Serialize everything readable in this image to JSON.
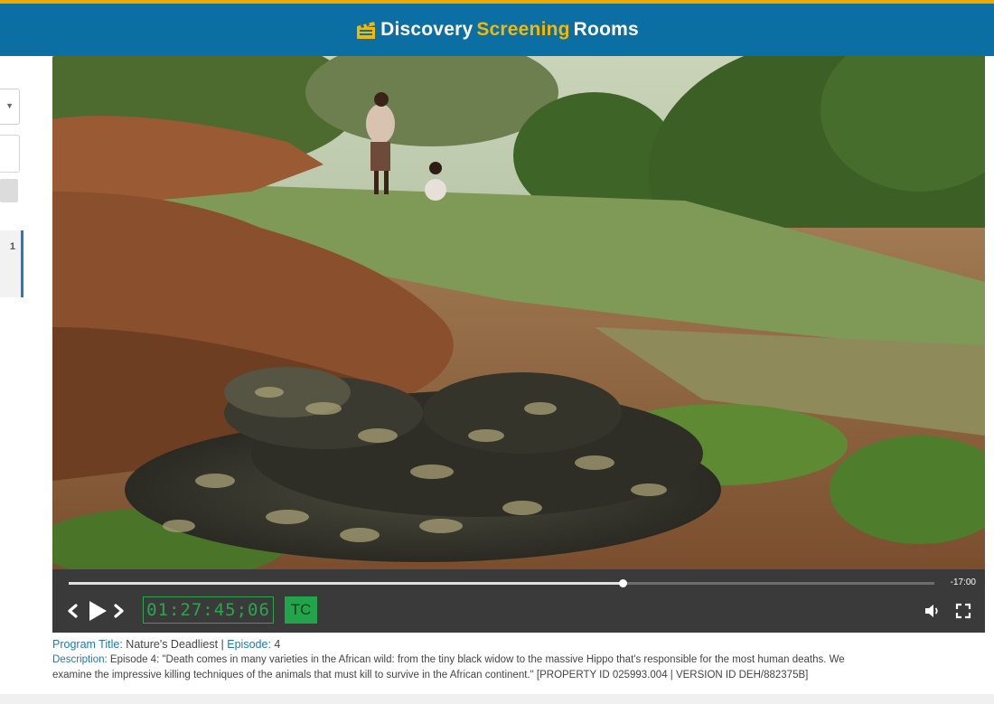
{
  "header": {
    "brand_part1": "Discovery",
    "brand_part2": "Screening",
    "brand_part3": "Rooms",
    "logo_icon": "clapperboard-icon",
    "brand_color": "#0b6fa3",
    "accent_color": "#f5b800"
  },
  "sidebar": {
    "item_number": "1"
  },
  "player": {
    "remaining": "-17:00",
    "timecode": "01:27:45;06",
    "tc_label": "TC",
    "progress": 0.64,
    "icons": {
      "prev": "chevron-left-icon",
      "play": "play-icon",
      "next": "chevron-right-icon",
      "volume": "volume-icon",
      "fullscreen": "fullscreen-icon"
    }
  },
  "info": {
    "program_title_label": "Program Title:",
    "program_title": "Nature's Deadliest",
    "separator": "|",
    "episode_label": "Episode:",
    "episode": "4",
    "description_label": "Description:",
    "description": "Episode 4: \"Death comes in many varieties in the African wild: from the tiny black widow to the massive Hippo that's responsible for the most human deaths. We examine the impressive killing techniques of the animals that must kill to survive in the African continent.\" [PROPERTY ID 025993.004 | VERSION ID DEH/882375B]"
  }
}
